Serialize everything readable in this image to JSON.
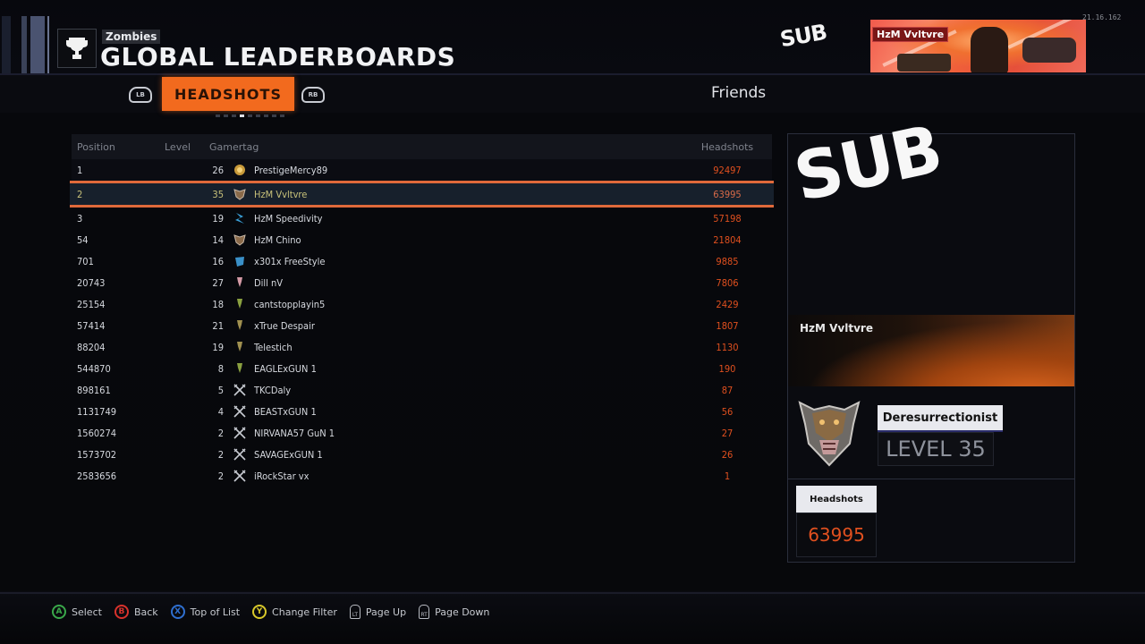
{
  "header": {
    "mode_label": "Zombies",
    "title": "GLOBAL LEADERBOARDS",
    "version": "21.16.162",
    "overlay_text": "SUB",
    "banner_gamertag": "HzM Vvltvre",
    "icon": "trophy-icon"
  },
  "tabs": {
    "left_bumper": "LB",
    "right_bumper": "RB",
    "active": "HEADSHOTS",
    "page_indicator": {
      "count": 9,
      "active_index": 3
    },
    "friends": "Friends"
  },
  "table": {
    "columns": [
      "Position",
      "Level",
      "Gamertag",
      "Headshots"
    ],
    "selected_index": 1,
    "rows": [
      {
        "position": "1",
        "level": "26",
        "rank_icon": "prestige-emblem-gold",
        "gamertag": "PrestigeMercy89",
        "headshots": "92497"
      },
      {
        "position": "2",
        "level": "35",
        "rank_icon": "prestige-emblem-dog",
        "gamertag": "HzM Vvltvre",
        "headshots": "63995"
      },
      {
        "position": "3",
        "level": "19",
        "rank_icon": "prestige-emblem-blue",
        "gamertag": "HzM Speedivity",
        "headshots": "57198"
      },
      {
        "position": "54",
        "level": "14",
        "rank_icon": "prestige-emblem-dog",
        "gamertag": "HzM Chino",
        "headshots": "21804"
      },
      {
        "position": "701",
        "level": "16",
        "rank_icon": "prestige-emblem-cyan",
        "gamertag": "x301x FreeStyle",
        "headshots": "9885"
      },
      {
        "position": "20743",
        "level": "27",
        "rank_icon": "rank-pin-pink",
        "gamertag": "Dill nV",
        "headshots": "7806"
      },
      {
        "position": "25154",
        "level": "18",
        "rank_icon": "rank-pin-green",
        "gamertag": "cantstopplayin5",
        "headshots": "2429"
      },
      {
        "position": "57414",
        "level": "21",
        "rank_icon": "rank-pin-olive",
        "gamertag": "xTrue Despair",
        "headshots": "1807"
      },
      {
        "position": "88204",
        "level": "19",
        "rank_icon": "rank-pin-olive",
        "gamertag": "Telestich",
        "headshots": "1130"
      },
      {
        "position": "544870",
        "level": "8",
        "rank_icon": "rank-pin-green",
        "gamertag": "EAGLExGUN 1",
        "headshots": "190"
      },
      {
        "position": "898161",
        "level": "5",
        "rank_icon": "crossed-swords",
        "gamertag": "TKCDaly",
        "headshots": "87"
      },
      {
        "position": "1131749",
        "level": "4",
        "rank_icon": "crossed-swords",
        "gamertag": "BEASTxGUN 1",
        "headshots": "56"
      },
      {
        "position": "1560274",
        "level": "2",
        "rank_icon": "crossed-swords",
        "gamertag": "NIRVANA57 GuN 1",
        "headshots": "27"
      },
      {
        "position": "1573702",
        "level": "2",
        "rank_icon": "crossed-swords",
        "gamertag": "SAVAGExGUN 1",
        "headshots": "26"
      },
      {
        "position": "2583656",
        "level": "2",
        "rank_icon": "crossed-swords",
        "gamertag": "iRockStar vx",
        "headshots": "1"
      }
    ]
  },
  "player_card": {
    "overlay_text": "SUB",
    "gamertag": "HzM Vvltvre",
    "title": "Deresurrectionist",
    "level": "LEVEL 35",
    "stat_label": "Headshots",
    "stat_value": "63995"
  },
  "footer": {
    "hints": [
      {
        "button": "A",
        "label": "Select",
        "color": "#3aa84a"
      },
      {
        "button": "B",
        "label": "Back",
        "color": "#d8322c"
      },
      {
        "button": "X",
        "label": "Top of List",
        "color": "#2f6fd0"
      },
      {
        "button": "Y",
        "label": "Change Filter",
        "color": "#d8c82a"
      },
      {
        "button": "LT",
        "label": "Page Up",
        "color": "#b8bbc2"
      },
      {
        "button": "RT",
        "label": "Page Down",
        "color": "#b8bbc2"
      }
    ]
  },
  "colors": {
    "accent": "#f26a1e",
    "value": "#e0501f",
    "selected_border": "#e0693a"
  }
}
